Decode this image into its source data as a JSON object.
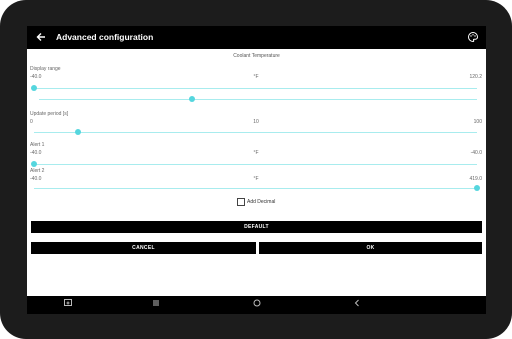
{
  "app_bar": {
    "title": "Advanced configuration",
    "back_icon": "arrow-left-icon",
    "action_icon": "palette-icon"
  },
  "section_title": "Coolant Temperature",
  "display_range": {
    "label": "Display range",
    "min": "-40.0",
    "unit": "°F",
    "max": "120.2",
    "low_value_fraction": 0.0,
    "high_value_fraction": 0.35
  },
  "update_period": {
    "label": "Update period [s]",
    "min": "0",
    "mid": "10",
    "max": "100",
    "value_fraction": 0.1
  },
  "alert1": {
    "label": "Alert 1",
    "min": "-40.0",
    "unit": "°F",
    "max": "-40.0",
    "value_fraction": 0.0
  },
  "alert2": {
    "label": "Alert 2",
    "min": "-40.0",
    "unit": "°F",
    "max": "419.0",
    "value_fraction": 1.0
  },
  "add_decimal": {
    "label": "Add Decimal",
    "checked": false
  },
  "buttons": {
    "default": "DEFAULT",
    "cancel": "CANCEL",
    "ok": "OK"
  },
  "nav_icons": [
    "screenshot-icon",
    "recents-icon",
    "home-icon",
    "back-icon"
  ],
  "colors": {
    "accent": "#55d6de",
    "track": "#a8ecee",
    "bar": "#000000"
  }
}
